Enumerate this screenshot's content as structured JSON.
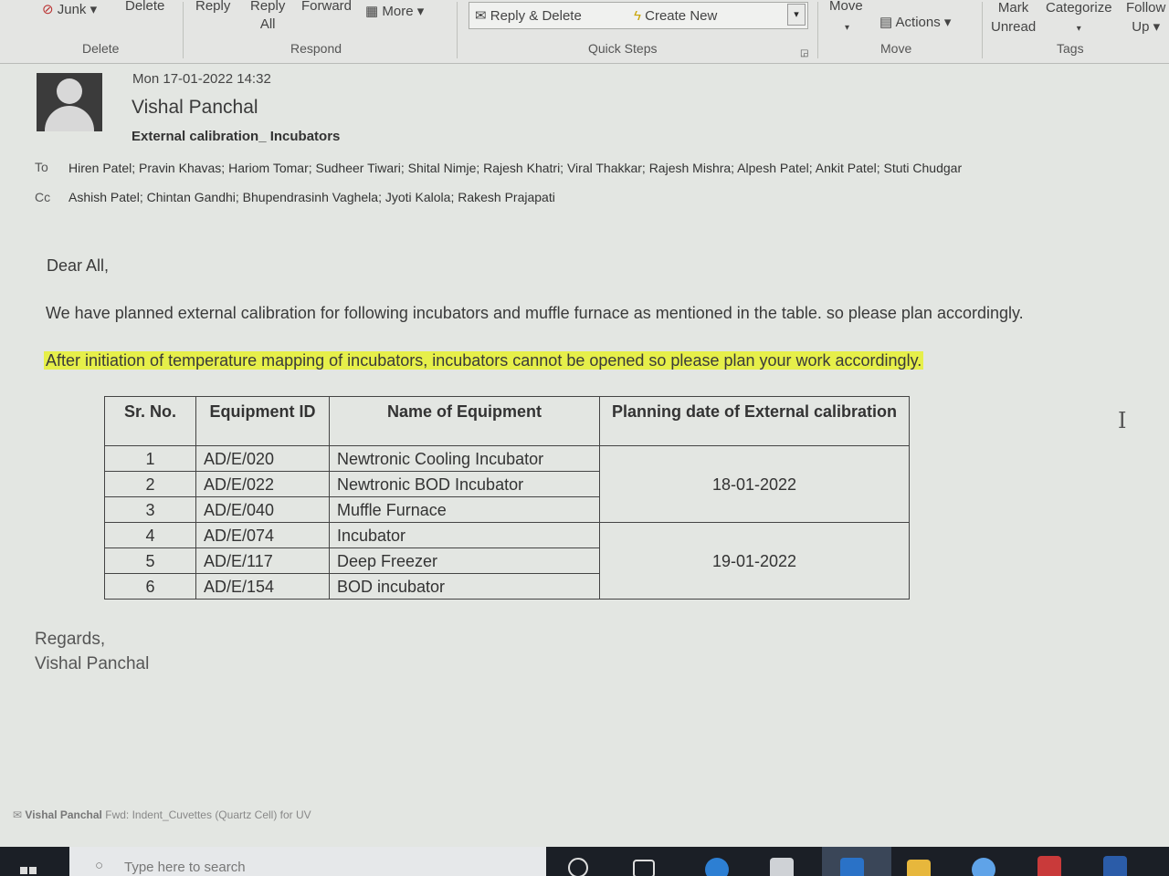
{
  "ribbon": {
    "junk": "Junk",
    "delete": "Delete",
    "reply": "Reply",
    "reply_all_1": "Reply",
    "reply_all_2": "All",
    "forward": "Forward",
    "more": "More",
    "reply_delete": "Reply & Delete",
    "create_new": "Create New",
    "move": "Move",
    "actions": "Actions",
    "mark_unread_1": "Mark",
    "mark_unread_2": "Unread",
    "categorize": "Categorize",
    "follow_up_1": "Follow",
    "follow_up_2": "Up",
    "groups": {
      "delete": "Delete",
      "respond": "Respond",
      "quick_steps": "Quick Steps",
      "move": "Move",
      "tags": "Tags"
    }
  },
  "email": {
    "date": "Mon 17-01-2022 14:32",
    "from": "Vishal Panchal",
    "subject": "External calibration_ Incubators",
    "to_label": "To",
    "to": "Hiren Patel; Pravin Khavas; Hariom Tomar; Sudheer Tiwari; Shital Nimje; Rajesh Khatri; Viral Thakkar; Rajesh Mishra; Alpesh Patel; Ankit Patel; Stuti Chudgar",
    "cc_label": "Cc",
    "cc": "Ashish Patel; Chintan Gandhi; Bhupendrasinh Vaghela; Jyoti Kalola; Rakesh Prajapati",
    "greeting": "Dear All,",
    "para1": "We have planned external calibration for following incubators and muffle furnace as mentioned in the table. so please plan accordingly.",
    "para2": "After initiation of temperature mapping of incubators, incubators cannot be opened so please plan your work accordingly.",
    "table": {
      "headers": [
        "Sr. No.",
        "Equipment ID",
        "Name of Equipment",
        "Planning date of External calibration"
      ],
      "rows": [
        {
          "sr": "1",
          "id": "AD/E/020",
          "name": "Newtronic Cooling Incubator"
        },
        {
          "sr": "2",
          "id": "AD/E/022",
          "name": "Newtronic BOD Incubator"
        },
        {
          "sr": "3",
          "id": "AD/E/040",
          "name": "Muffle Furnace"
        },
        {
          "sr": "4",
          "id": "AD/E/074",
          "name": "Incubator"
        },
        {
          "sr": "5",
          "id": "AD/E/117",
          "name": "Deep Freezer"
        },
        {
          "sr": "6",
          "id": "AD/E/154",
          "name": "BOD incubator"
        }
      ],
      "date_group_1": "18-01-2022",
      "date_group_2": "19-01-2022"
    },
    "regards": "Regards,",
    "signature": "Vishal Panchal"
  },
  "footer_note": {
    "sender": "Vishal Panchal",
    "text": "Fwd: Indent_Cuvettes (Quartz Cell) for UV"
  },
  "taskbar": {
    "search_placeholder": "Type here to search"
  },
  "colors": {
    "highlight": "#e6ef4a",
    "taskbar": "#1b1f26"
  }
}
